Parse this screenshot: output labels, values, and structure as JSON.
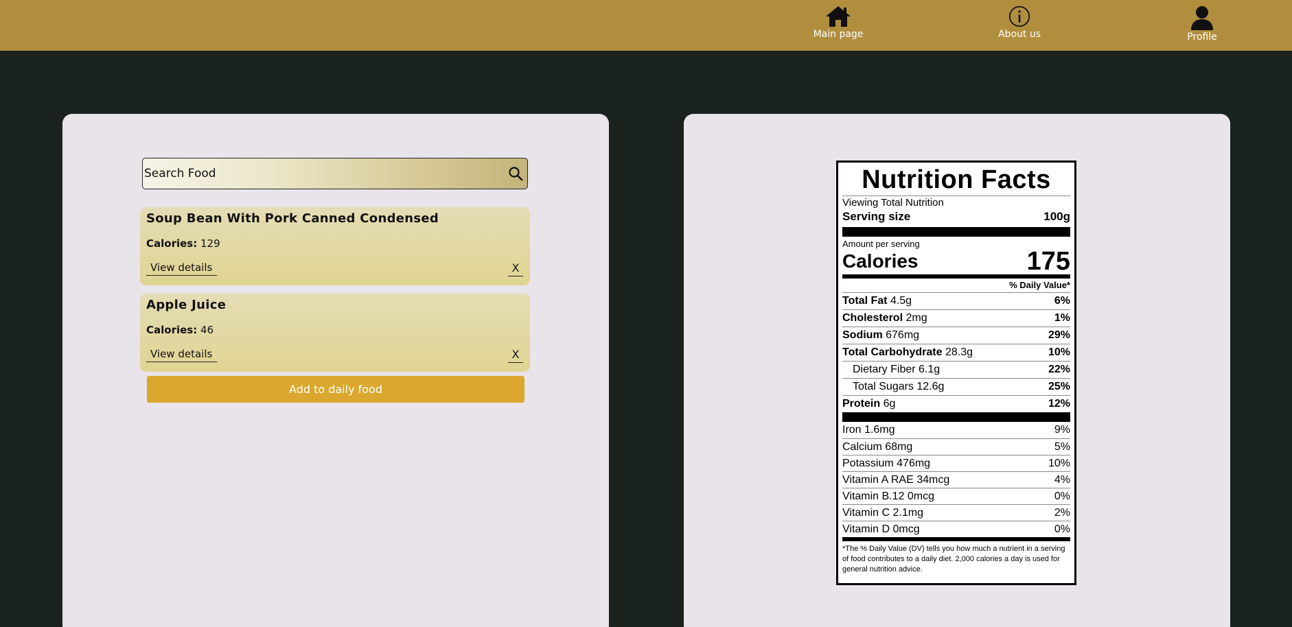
{
  "nav": {
    "items": [
      {
        "label": "Main page",
        "icon": "home-icon"
      },
      {
        "label": "About us",
        "icon": "info-icon"
      },
      {
        "label": "Profile",
        "icon": "user-icon"
      }
    ]
  },
  "search": {
    "placeholder": "Search Food",
    "value": ""
  },
  "foods": [
    {
      "name": "Soup Bean With Pork Canned Condensed",
      "calories_label": "Calories:",
      "calories": "129",
      "view_label": "View details",
      "remove_label": "X"
    },
    {
      "name": "Apple Juice",
      "calories_label": "Calories:",
      "calories": "46",
      "view_label": "View details",
      "remove_label": "X"
    }
  ],
  "add_button_label": "Add to daily food",
  "nutrition": {
    "title": "Nutrition Facts",
    "viewing": "Viewing Total Nutrition",
    "serving_label": "Serving size",
    "serving_value": "100g",
    "amount_per_serving": "Amount per serving",
    "calories_label": "Calories",
    "calories_value": "175",
    "dv_header": "% Daily Value*",
    "rows": [
      {
        "name": "Total Fat",
        "amount": "4.5g",
        "dv": "6%"
      },
      {
        "name": "Cholesterol",
        "amount": "2mg",
        "dv": "1%"
      },
      {
        "name": "Sodium",
        "amount": "676mg",
        "dv": "29%"
      },
      {
        "name": "Total Carbohydrate",
        "amount": "28.3g",
        "dv": "10%"
      },
      {
        "name": "Dietary Fiber",
        "amount": "6.1g",
        "dv": "22%"
      },
      {
        "name": "Total Sugars",
        "amount": "12.6g",
        "dv": "25%"
      },
      {
        "name": "Protein",
        "amount": "6g",
        "dv": "12%"
      }
    ],
    "minerals": [
      {
        "label": "Iron 1.6mg",
        "dv": "9%"
      },
      {
        "label": "Calcium 68mg",
        "dv": "5%"
      },
      {
        "label": "Potassium 476mg",
        "dv": "10%"
      },
      {
        "label": "Vitamin A RAE 34mcg",
        "dv": "4%"
      },
      {
        "label": "Vitamin B.12 0mcg",
        "dv": "0%"
      },
      {
        "label": "Vitamin C 2.1mg",
        "dv": "2%"
      },
      {
        "label": "Vitamin D 0mcg",
        "dv": "0%"
      }
    ],
    "footnote": "*The % Daily Value (DV) tells you how much a nutrient in a serving of food contributes to a daily diet. 2,000 calories a day is used for general nutrition advice."
  },
  "colors": {
    "header": "#b08e3e",
    "background": "#1a221e",
    "panel": "#e9e4ea",
    "accent_button": "#dba72e"
  }
}
